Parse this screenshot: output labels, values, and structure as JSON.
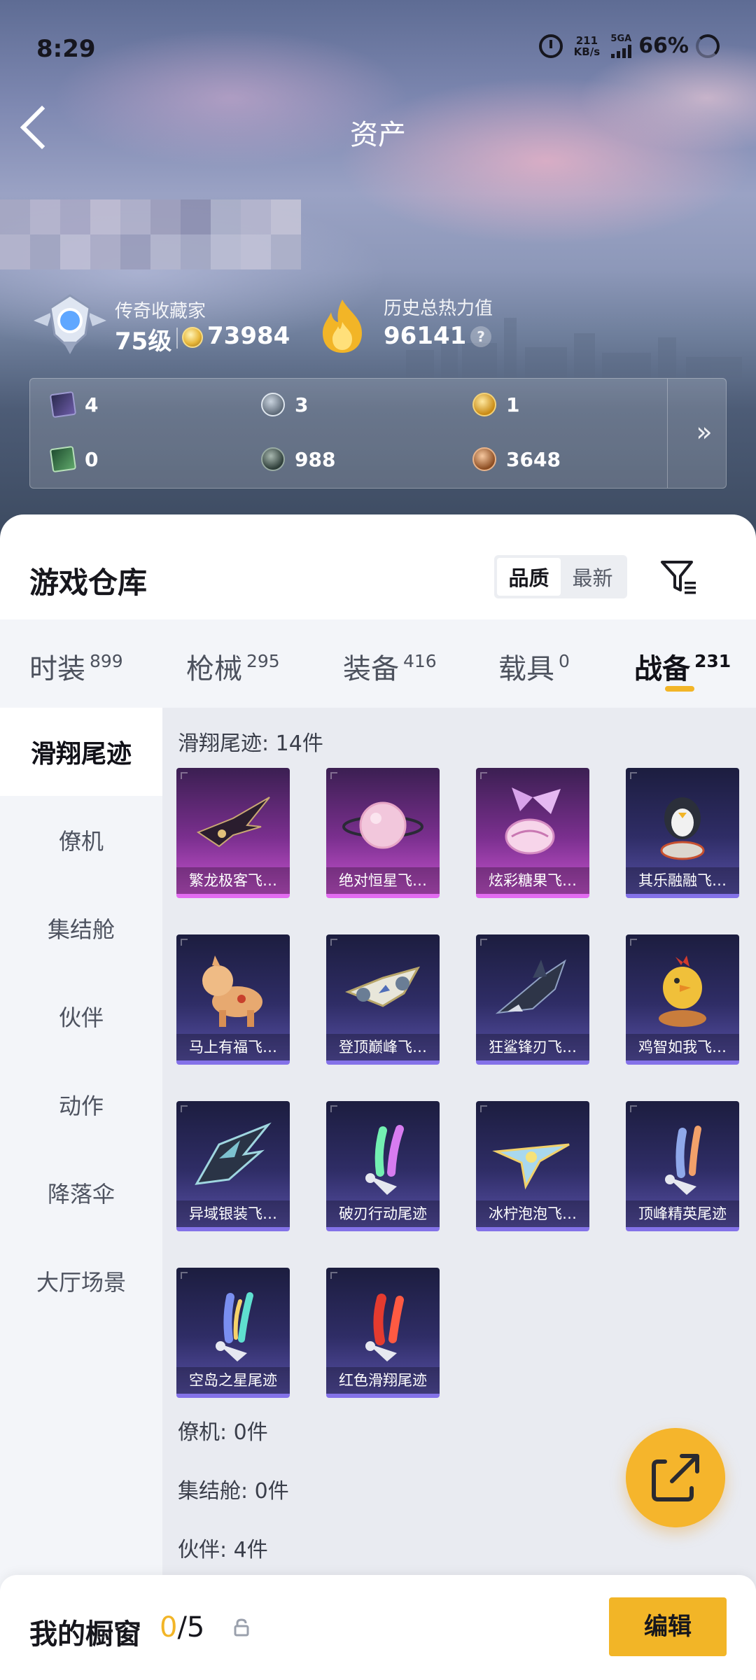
{
  "status_bar": {
    "time": "8:29",
    "net_speed_value": "211",
    "net_speed_unit": "KB/s",
    "network_label": "5GA",
    "battery": "66%"
  },
  "header": {
    "title": "资产"
  },
  "profile": {
    "rank_title": "传奇收藏家",
    "level": "75级",
    "coins": "73984",
    "heat_title": "历史总热力值",
    "heat_value": "96141",
    "help_label": "?"
  },
  "stats": [
    {
      "icon": "purple-card-icon",
      "value": "4"
    },
    {
      "icon": "silver-coin-icon",
      "value": "3"
    },
    {
      "icon": "gold-coin-icon",
      "value": "1"
    },
    {
      "icon": "green-card-icon",
      "value": "0"
    },
    {
      "icon": "dark-coin-icon",
      "value": "988"
    },
    {
      "icon": "bronze-coin-icon",
      "value": "3648"
    }
  ],
  "warehouse": {
    "title": "游戏仓库",
    "sort_options": [
      "品质",
      "最新"
    ],
    "sort_selected": "品质"
  },
  "tabs": [
    {
      "label": "时装",
      "count": "899"
    },
    {
      "label": "枪械",
      "count": "295"
    },
    {
      "label": "装备",
      "count": "416"
    },
    {
      "label": "载具",
      "count": "0"
    },
    {
      "label": "战备",
      "count": "231",
      "active": true
    }
  ],
  "sidebar": [
    {
      "label": "滑翔尾迹",
      "active": true
    },
    {
      "label": "僚机"
    },
    {
      "label": "集结舱"
    },
    {
      "label": "伙伴"
    },
    {
      "label": "动作"
    },
    {
      "label": "降落伞"
    },
    {
      "label": "大厅场景"
    }
  ],
  "groups": [
    {
      "title": "滑翔尾迹: 14件"
    },
    {
      "title": "僚机: 0件"
    },
    {
      "title": "集结舱: 0件"
    },
    {
      "title": "伙伴: 4件"
    }
  ],
  "items": [
    {
      "name": "繁龙极客飞…",
      "rarity": "purple",
      "icon": "dragon-glider-icon"
    },
    {
      "name": "绝对恒星飞…",
      "rarity": "purple",
      "icon": "planet-glider-icon"
    },
    {
      "name": "炫彩糖果飞…",
      "rarity": "purple",
      "icon": "candy-glider-icon"
    },
    {
      "name": "其乐融融飞…",
      "rarity": "blue",
      "icon": "penguin-glider-icon"
    },
    {
      "name": "马上有福飞…",
      "rarity": "blue",
      "icon": "horse-glider-icon"
    },
    {
      "name": "登顶巅峰飞…",
      "rarity": "blue",
      "icon": "jet-glider-icon"
    },
    {
      "name": "狂鲨锋刃飞…",
      "rarity": "blue",
      "icon": "shark-glider-icon"
    },
    {
      "name": "鸡智如我飞…",
      "rarity": "blue",
      "icon": "chicken-glider-icon"
    },
    {
      "name": "异域银装飞…",
      "rarity": "blue",
      "icon": "silver-wing-glider-icon"
    },
    {
      "name": "破刃行动尾迹",
      "rarity": "blue",
      "icon": "rainbow-trail-icon"
    },
    {
      "name": "冰柠泡泡飞…",
      "rarity": "blue",
      "icon": "lemon-plane-glider-icon"
    },
    {
      "name": "顶峰精英尾迹",
      "rarity": "blue",
      "icon": "blue-orange-trail-icon"
    },
    {
      "name": "空岛之星尾迹",
      "rarity": "blue",
      "icon": "sky-island-trail-icon"
    },
    {
      "name": "红色滑翔尾迹",
      "rarity": "blue",
      "icon": "red-trail-icon"
    }
  ],
  "showcase": {
    "label": "我的橱窗",
    "current": "0",
    "total": "/5"
  },
  "edit_label": "编辑",
  "colors": {
    "accent": "#f2b527",
    "rarity_purple": "#c653cf",
    "rarity_blue": "#5750a6"
  }
}
